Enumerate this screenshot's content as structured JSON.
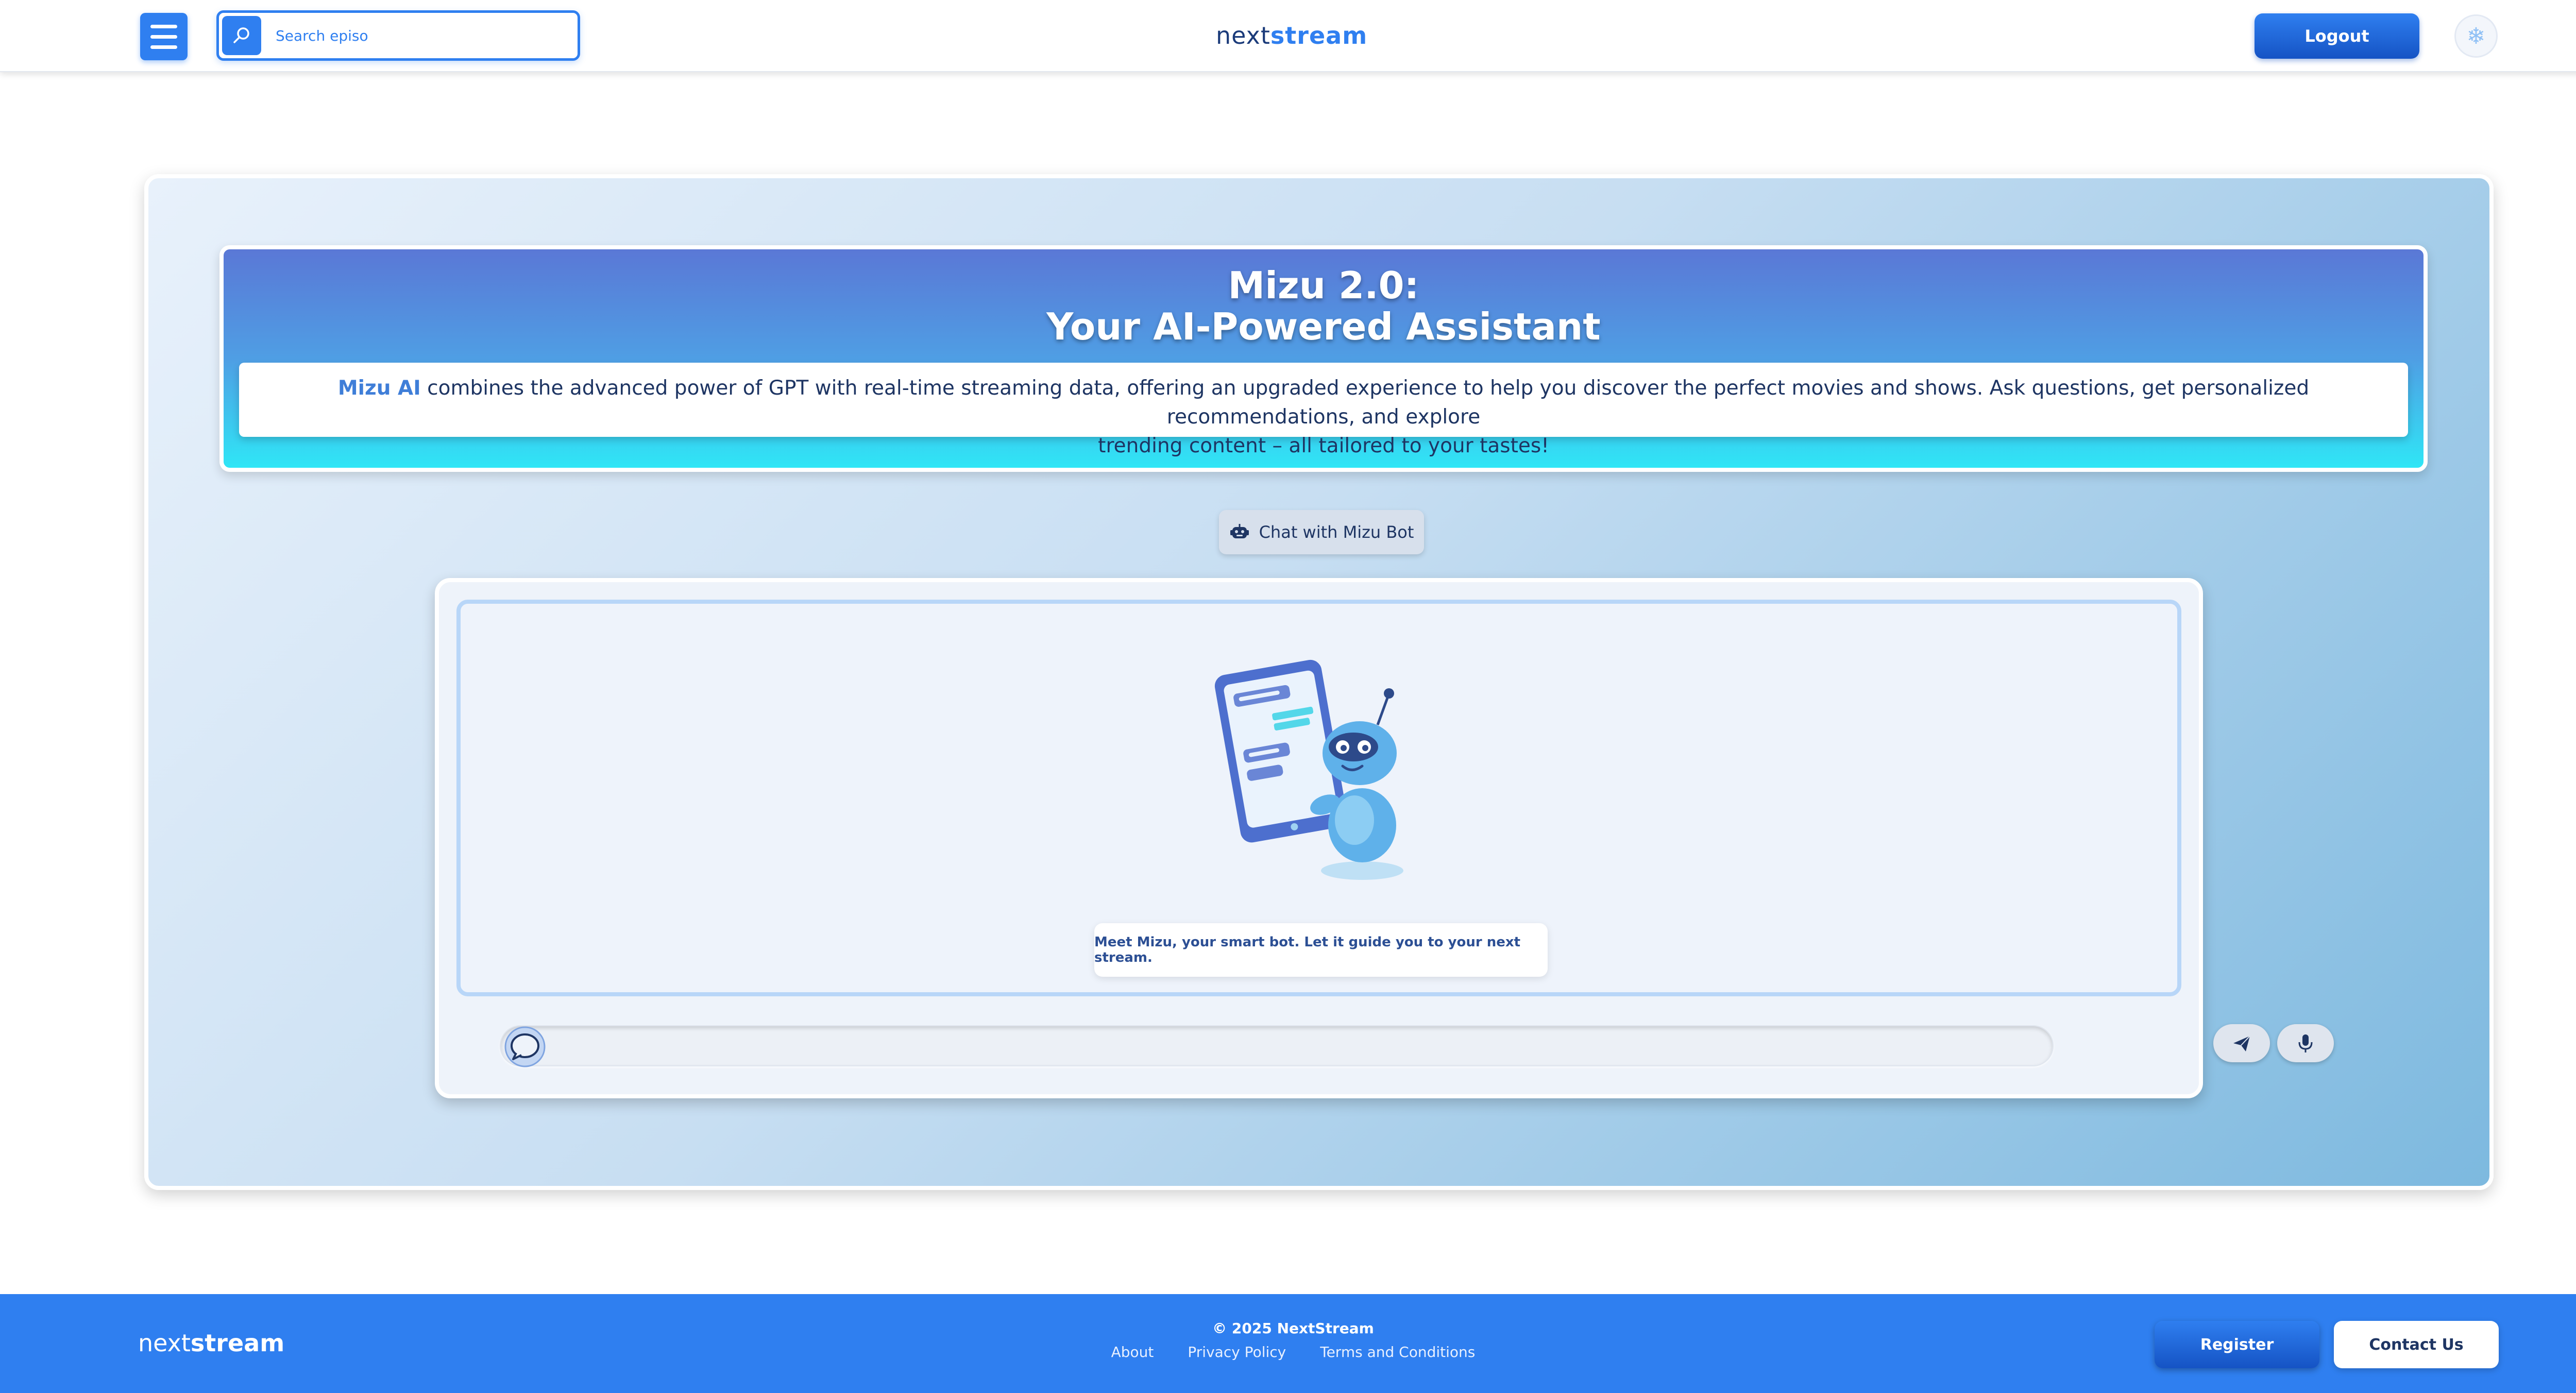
{
  "header": {
    "search_placeholder": "Search episo",
    "logo_light": "next",
    "logo_bold": "stream",
    "logout_label": "Logout",
    "theme_icon": "snowflake-icon"
  },
  "hero": {
    "title_line1": "Mizu 2.0:",
    "title_line2": "Your AI-Powered Assistant",
    "brand": "Mizu AI",
    "description_line1": "combines the advanced power of GPT with real-time streaming data, offering an upgraded experience to help you discover the perfect movies and shows. Ask questions, get personalized recommendations, and explore",
    "description_line2": "trending content – all tailored to your tastes!"
  },
  "chat": {
    "tag_label": "Chat with Mizu Bot",
    "caption": "Meet Mizu, your smart bot. Let it guide you to your next stream.",
    "input_value": "",
    "icons": {
      "bubble": "chat-bubble-icon",
      "send": "paper-plane-icon",
      "mic": "microphone-icon"
    }
  },
  "footer": {
    "logo_light": "next",
    "logo_bold": "stream",
    "copyright": "© 2025 NextStream",
    "links": [
      "About",
      "Privacy Policy",
      "Terms and Conditions"
    ],
    "register_label": "Register",
    "contact_label": "Contact Us"
  },
  "colors": {
    "primary": "#2f7ff0",
    "primary_dark": "#1553c4",
    "text_dark": "#1e3563",
    "hero_top": "#5a78d6",
    "hero_bottom": "#2fe6f6"
  }
}
